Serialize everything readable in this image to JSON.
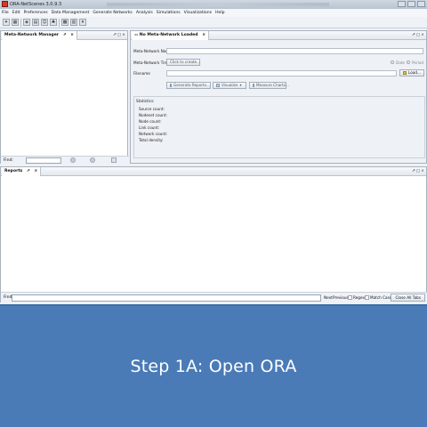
{
  "window": {
    "title": "ORA-NetScenes 3.0.9.3"
  },
  "menu": [
    "File",
    "Edit",
    "Preferences",
    "Data Management",
    "Generate Networks",
    "Analysis",
    "Simulations",
    "Visualizations",
    "Help"
  ],
  "toolbar": {
    "icons": [
      "magic-wand-icon",
      "grid-icon",
      "network-icon",
      "chart-icon",
      "person-icon",
      "tree-icon",
      "matrix-icon",
      "layout-icon",
      "dropdown-icon"
    ]
  },
  "meta_network_manager": {
    "tab_label": "Meta-Network Manager",
    "close_glyph": "×",
    "find_label": "Find:"
  },
  "network_panel": {
    "tab_label": "No Meta-Network Loaded",
    "close_glyph": "×",
    "fields": {
      "name_label": "Meta-Network Name",
      "time_label": "Meta-Network Time",
      "time_button": "Click to create...",
      "filename_label": "Filename",
      "date_option": "Date",
      "period_option": "Period",
      "load_button": "Load..."
    },
    "actions": {
      "generate_reports": "Generate Reports...",
      "visualize": "Visualize",
      "measure_charts": "Measure Charts..."
    },
    "statistics": {
      "title": "Statistics:",
      "lines": [
        "Source count:",
        "Nodeset count:",
        "Node count:",
        "Link count:",
        "Network count:",
        "Total density:"
      ]
    }
  },
  "reports": {
    "tab_label": "Reports",
    "close_glyph": "×",
    "find_label": "Find:",
    "next": "Next",
    "previous": "Previous",
    "regex": "Regex",
    "match_case": "Match Case",
    "close_all_tabs": "Close All Tabs"
  },
  "banner": {
    "caption": "Step 1A: Open ORA"
  },
  "colors": {
    "banner": "#4a7bb7",
    "window": "#eef1f5"
  }
}
